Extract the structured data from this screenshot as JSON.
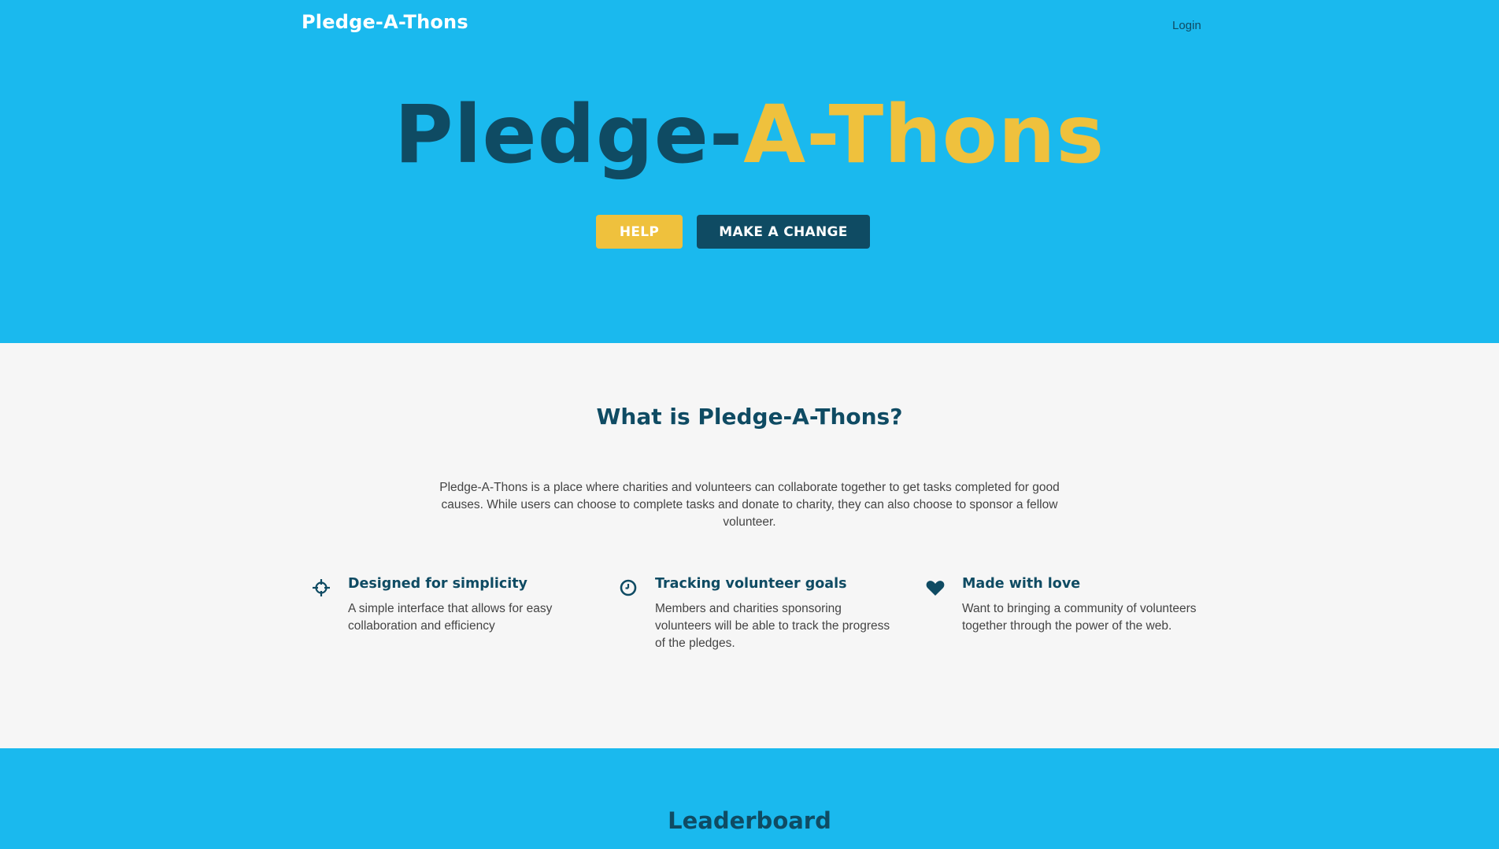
{
  "nav": {
    "brand": "Pledge-A-Thons",
    "login": "Login"
  },
  "hero": {
    "title_part1": "Pledge-",
    "title_part2": "A-Thons",
    "help_button": "HELP",
    "change_button": "MAKE A CHANGE"
  },
  "about": {
    "title": "What is Pledge-A-Thons?",
    "description": "Pledge-A-Thons is a place where charities and volunteers can collaborate together to get tasks completed for good causes. While users can choose to complete tasks and donate to charity, they can also choose to sponsor a fellow volunteer.",
    "features": [
      {
        "icon": "crosshair-icon",
        "title": "Designed for simplicity",
        "text": "A simple interface that allows for easy collaboration and efficiency"
      },
      {
        "icon": "clock-icon",
        "title": "Tracking volunteer goals",
        "text": "Members and charities sponsoring volunteers will be able to track the progress of the pledges."
      },
      {
        "icon": "heart-icon",
        "title": "Made with love",
        "text": "Want to bringing a community of volunteers together through the power of the web."
      }
    ]
  },
  "leaderboard": {
    "title": "Leaderboard"
  },
  "colors": {
    "primary_blue": "#1ab9ee",
    "dark_teal": "#0f4b63",
    "accent_yellow": "#efc13d",
    "light_bg": "#f6f6f6"
  }
}
